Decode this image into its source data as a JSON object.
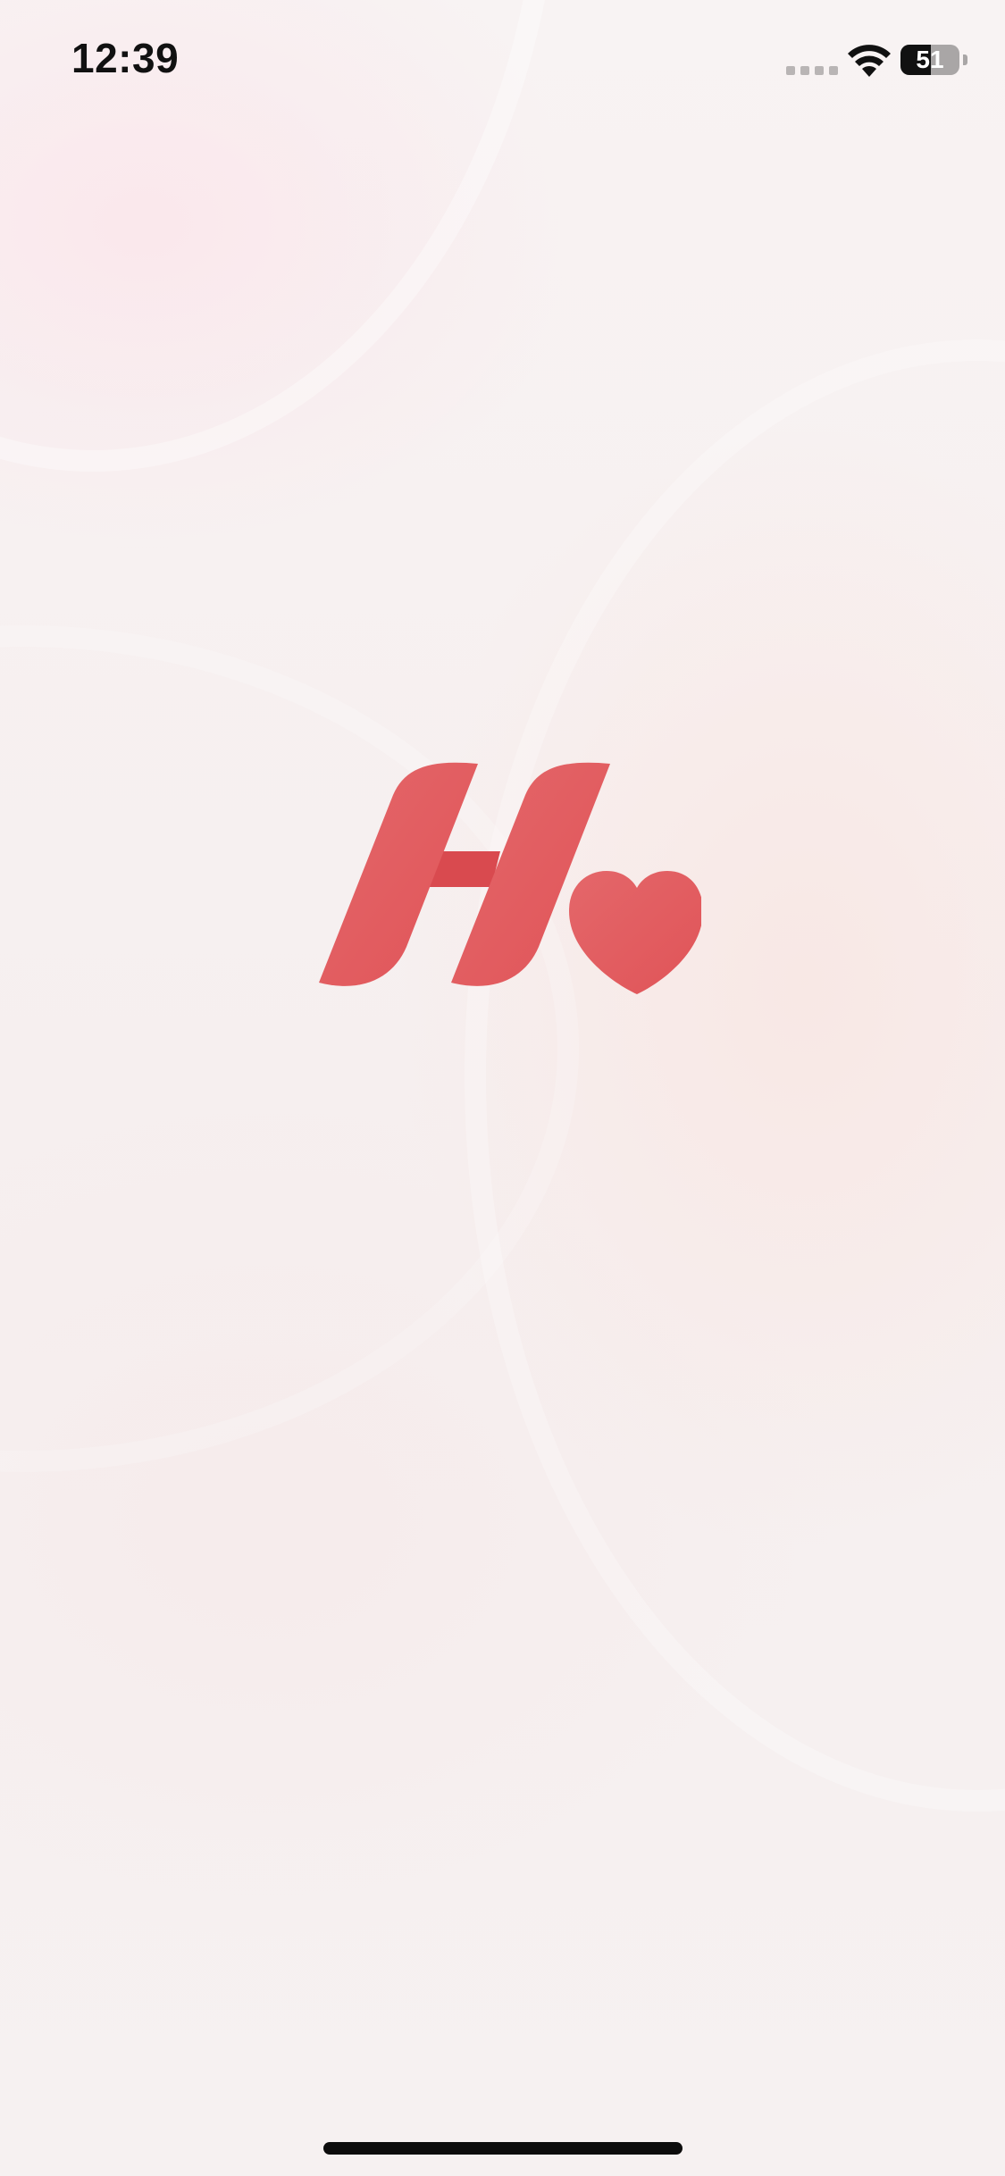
{
  "status_bar": {
    "time": "12:39",
    "battery_percent": 51,
    "battery_label": "51",
    "signal_icon": "cellular-signal-icon",
    "wifi_icon": "wifi-icon"
  },
  "splash": {
    "logo_icon": "h-heart-logo-icon",
    "logo_color": "#e35a5d"
  },
  "colors": {
    "background": "#f6f1f1",
    "text": "#111111"
  }
}
